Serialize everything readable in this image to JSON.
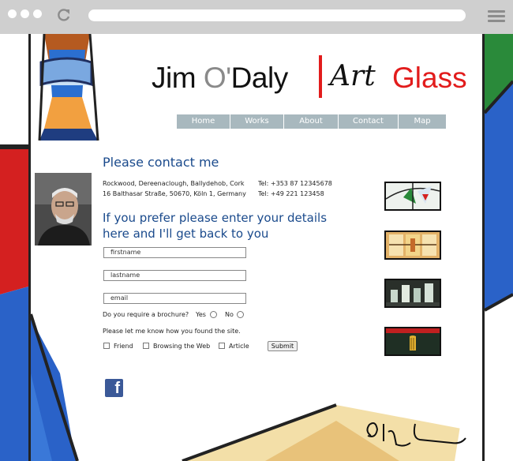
{
  "header": {
    "logo_jim": "Jim ",
    "logo_o": "O'",
    "logo_daly": "Daly",
    "logo_art": "Art",
    "logo_glass": "Glass"
  },
  "nav": [
    {
      "label": "Home"
    },
    {
      "label": "Works"
    },
    {
      "label": "About"
    },
    {
      "label": "Contact"
    },
    {
      "label": "Map"
    }
  ],
  "contact": {
    "heading": "Please contact me",
    "address1": "Rockwood, Dereenaclough, Ballydehob, Cork",
    "address2": "16 Balthasar Straße, 50670, Köln 1, Germany",
    "tel1": "Tel: +353 87 12345678",
    "tel2": "Tel: +49 221 123458"
  },
  "form": {
    "heading": "If you prefer please enter your details here and I'll get back to you",
    "firstname": "firstname",
    "lastname": "lastname",
    "email": "email",
    "brochure_question": "Do you require a brochure?",
    "yes": "Yes",
    "no": "No",
    "found_question": "Please let me know how you found the site.",
    "opt_friend": "Friend",
    "opt_web": "Browsing the Web",
    "opt_article": "Article",
    "submit": "Submit"
  },
  "social": {
    "facebook": "f"
  },
  "colors": {
    "heading_blue": "#1a4a8c",
    "logo_red": "#e21c1c",
    "nav_bg": "#a8b8be",
    "chrome_gray": "#cfcfcf"
  },
  "icons": [
    "reload-icon",
    "hamburger-menu-icon",
    "facebook-icon",
    "signature-icon"
  ]
}
